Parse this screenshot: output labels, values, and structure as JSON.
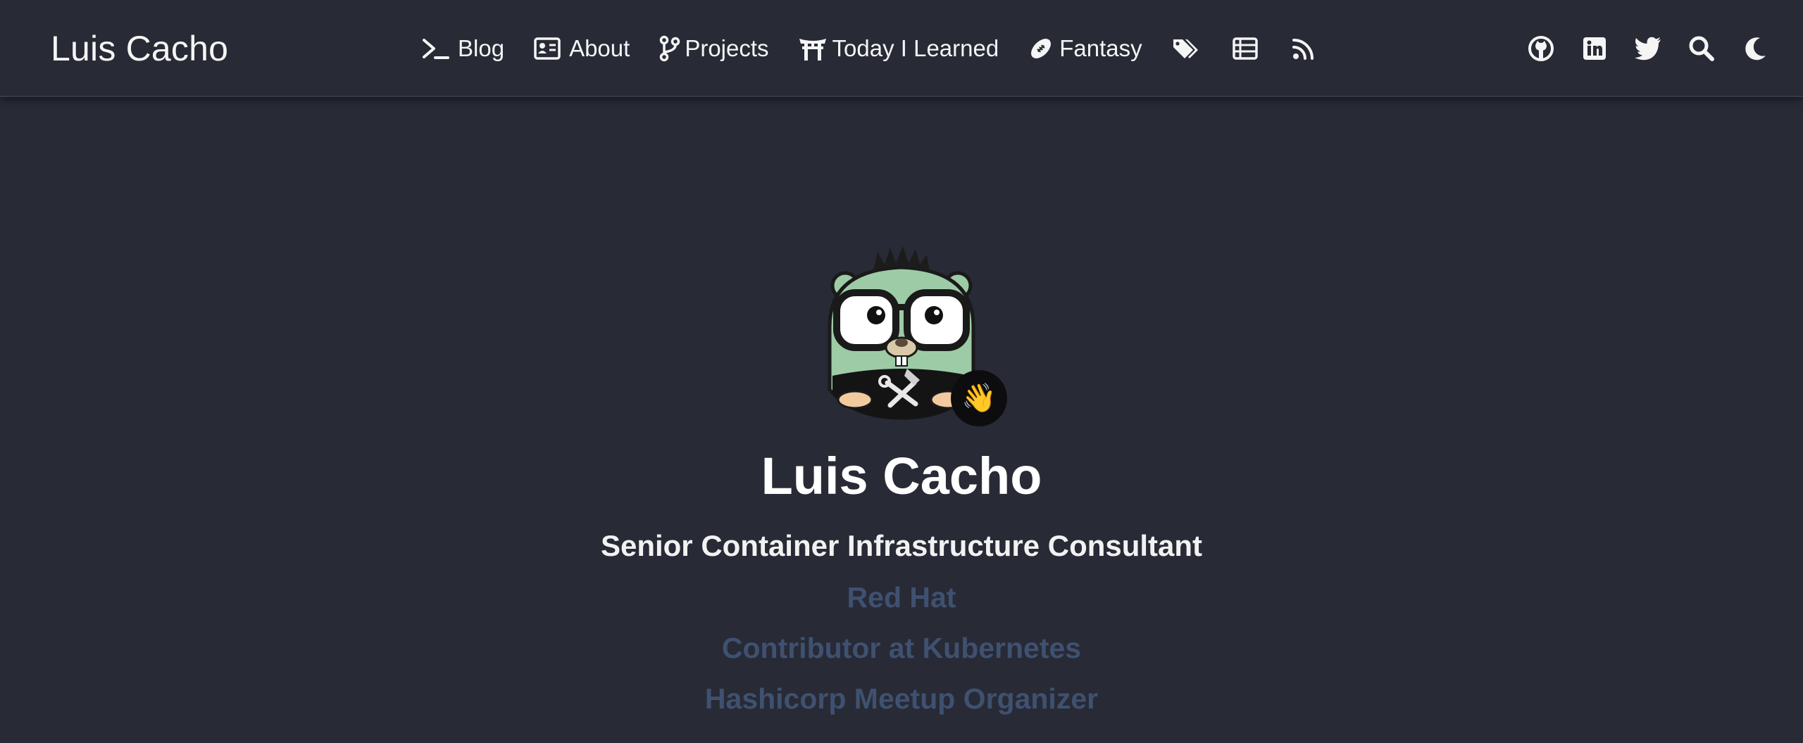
{
  "header": {
    "brand": "Luis Cacho",
    "menu": [
      {
        "label": "Blog",
        "icon": "terminal-icon"
      },
      {
        "label": "About",
        "icon": "id-card-icon"
      },
      {
        "label": "Projects",
        "icon": "code-branch-icon"
      },
      {
        "label": "Today I Learned",
        "icon": "torii-gate-icon"
      },
      {
        "label": "Fantasy",
        "icon": "football-icon"
      },
      {
        "label": "",
        "icon": "tags-icon"
      },
      {
        "label": "",
        "icon": "list-icon"
      },
      {
        "label": "",
        "icon": "rss-icon"
      }
    ],
    "right_icons": [
      "github-icon",
      "linkedin-icon",
      "twitter-icon",
      "search-icon",
      "moon-icon"
    ]
  },
  "profile": {
    "avatar": "gopher-avatar",
    "badge_emoji": "👋",
    "name": "Luis Cacho",
    "title": "Senior Container Infrastructure Consultant",
    "lines": [
      "Red Hat",
      "Contributor at Kubernetes",
      "Hashicorp Meetup Organizer"
    ]
  },
  "colors": {
    "background": "#282a36",
    "text": "#f5f5f5",
    "muted_link": "#3f5170"
  }
}
